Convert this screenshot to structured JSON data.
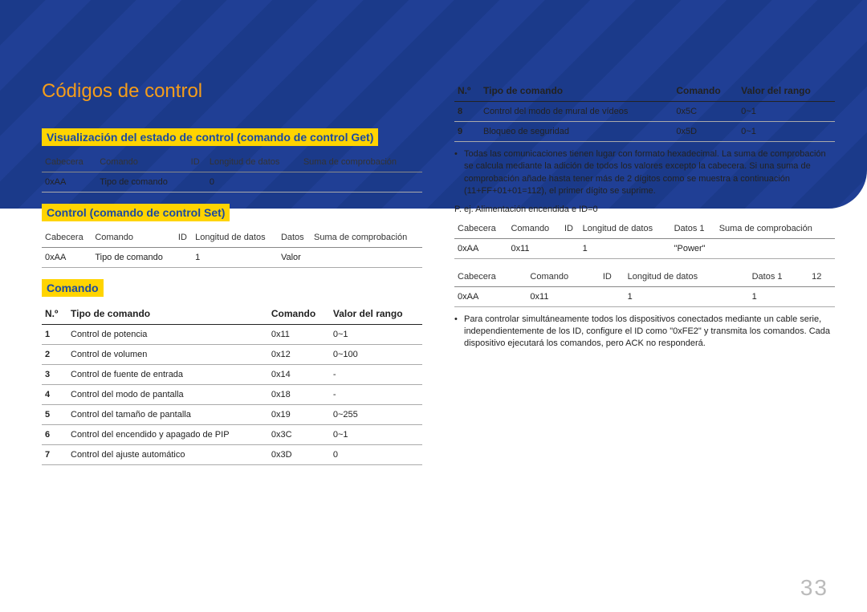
{
  "title": "Códigos de control",
  "section_get": "Visualización del estado de control (comando de control Get)",
  "section_set": "Control (comando de control Set)",
  "section_cmd": "Comando",
  "headers_packet5": [
    "Cabecera",
    "Comando",
    "ID",
    "Longitud de datos",
    "Suma de comprobación"
  ],
  "headers_packet6": [
    "Cabecera",
    "Comando",
    "ID",
    "Longitud de datos",
    "Datos",
    "Suma de comprobación"
  ],
  "headers_packet6b": [
    "Cabecera",
    "Comando",
    "ID",
    "Longitud de datos",
    "Datos 1",
    "Suma de comprobación"
  ],
  "headers_packet6c": [
    "Cabecera",
    "Comando",
    "ID",
    "Longitud de datos",
    "Datos 1",
    "12"
  ],
  "get_row": [
    "0xAA",
    "Tipo de comando",
    "",
    "0",
    ""
  ],
  "set_row": [
    "0xAA",
    "Tipo de comando",
    "",
    "1",
    "Valor",
    ""
  ],
  "cmd_headers": [
    "N.º",
    "Tipo de comando",
    "Comando",
    "Valor del rango"
  ],
  "commands_left": [
    {
      "n": "1",
      "tipo": "Control de potencia",
      "cmd": "0x11",
      "rango": "0~1"
    },
    {
      "n": "2",
      "tipo": "Control de volumen",
      "cmd": "0x12",
      "rango": "0~100"
    },
    {
      "n": "3",
      "tipo": "Control de fuente de entrada",
      "cmd": "0x14",
      "rango": "-"
    },
    {
      "n": "4",
      "tipo": "Control del modo de pantalla",
      "cmd": "0x18",
      "rango": "-"
    },
    {
      "n": "5",
      "tipo": "Control del tamaño de pantalla",
      "cmd": "0x19",
      "rango": "0~255"
    },
    {
      "n": "6",
      "tipo": "Control del encendido y apagado de PIP",
      "cmd": "0x3C",
      "rango": "0~1"
    },
    {
      "n": "7",
      "tipo": "Control del ajuste automático",
      "cmd": "0x3D",
      "rango": "0"
    }
  ],
  "commands_right": [
    {
      "n": "8",
      "tipo": "Control del modo de mural de vídeos",
      "cmd": "0x5C",
      "rango": "0~1"
    },
    {
      "n": "9",
      "tipo": "Bloqueo de seguridad",
      "cmd": "0x5D",
      "rango": "0~1"
    }
  ],
  "bullet1": "Todas las comunicaciones tienen lugar con formato hexadecimal. La suma de comprobación se calcula mediante la adición de todos los valores excepto la cabecera. Si una suma de comprobación añade hasta tener más de 2 dígitos como se muestra a continuación (11+FF+01+01=112), el primer dígito se suprime.",
  "example_label": "P. ej. Alimentación encendida e ID=0",
  "ex_row1": [
    "0xAA",
    "0x11",
    "",
    "1",
    "\"Power\"",
    ""
  ],
  "ex_row2": [
    "0xAA",
    "0x11",
    "",
    "1",
    "1",
    ""
  ],
  "bullet2": "Para controlar simultáneamente todos los dispositivos conectados mediante un cable serie, independientemente de los ID, configure el ID como \"0xFE2\" y transmita los comandos. Cada dispositivo ejecutará los comandos, pero ACK no responderá.",
  "page_number": "33"
}
